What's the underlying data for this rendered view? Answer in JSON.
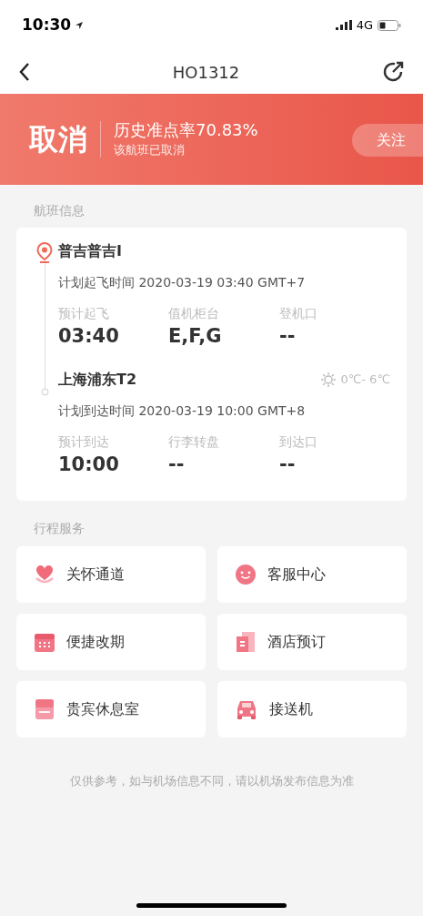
{
  "status_bar": {
    "time": "10:30",
    "network": "4G"
  },
  "nav": {
    "title": "HO1312"
  },
  "banner": {
    "status": "取消",
    "on_time_rate": "历史准点率70.83%",
    "note": "该航班已取消",
    "follow_button": "关注"
  },
  "flight_info": {
    "heading": "航班信息",
    "departure": {
      "airport": "普吉普吉I",
      "scheduled": "计划起飞时间 2020-03-19 03:40 GMT+7",
      "fields": [
        {
          "label": "预计起飞",
          "value": "03:40"
        },
        {
          "label": "值机柜台",
          "value": "E,F,G"
        },
        {
          "label": "登机口",
          "value": "--"
        }
      ]
    },
    "arrival": {
      "airport": "上海浦东T2",
      "weather": "0℃- 6℃",
      "scheduled": "计划到达时间 2020-03-19 10:00 GMT+8",
      "fields": [
        {
          "label": "预计到达",
          "value": "10:00"
        },
        {
          "label": "行李转盘",
          "value": "--"
        },
        {
          "label": "到达口",
          "value": "--"
        }
      ]
    }
  },
  "services": {
    "heading": "行程服务",
    "items": [
      {
        "label": "关怀通道",
        "kind": "heart"
      },
      {
        "label": "客服中心",
        "kind": "smile"
      },
      {
        "label": "便捷改期",
        "kind": "calendar"
      },
      {
        "label": "酒店预订",
        "kind": "hotel"
      },
      {
        "label": "贵宾休息室",
        "kind": "lounge"
      },
      {
        "label": "接送机",
        "kind": "car"
      }
    ]
  },
  "disclaimer": "仅供参考，如与机场信息不同，请以机场发布信息为准"
}
